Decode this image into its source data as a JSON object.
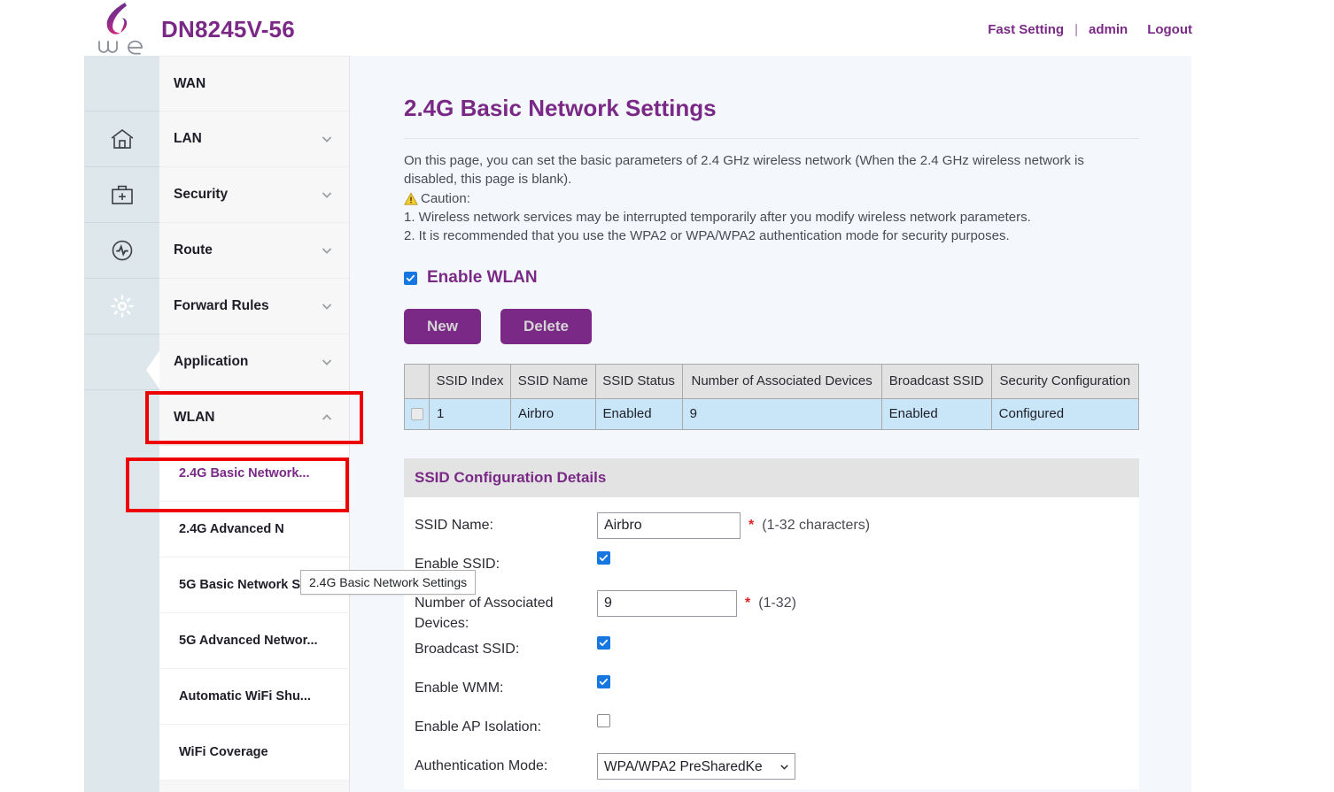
{
  "header": {
    "brand_title": "DN8245V-56",
    "logo_alt": "we-logo",
    "links": [
      {
        "label": "Fast Setting",
        "name": "fast-setting-link"
      },
      {
        "label": "admin",
        "name": "admin-link"
      },
      {
        "label": "Logout",
        "name": "logout-link"
      }
    ],
    "separator": "|"
  },
  "colors": {
    "brand_purple": "#7a2a86",
    "checkbox_blue": "#1677e0",
    "annotation_red": "#ee0000",
    "table_row_blue": "#c9e6f9",
    "table_header_gray": "#e2e2e2",
    "content_bg": "#f4f8fd",
    "rail_bg": "#dde7ec"
  },
  "rail": {
    "items": [
      {
        "icon": "blank-icon",
        "active": false
      },
      {
        "icon": "home-icon",
        "active": false
      },
      {
        "icon": "firstaid-kit-icon",
        "active": false
      },
      {
        "icon": "activity-circle-icon",
        "active": false
      },
      {
        "icon": "gear-icon",
        "active": true
      },
      {
        "icon": "blank-icon",
        "active": false
      }
    ],
    "collapse_icon": "chevron-left-icon"
  },
  "sidebar": {
    "items": [
      {
        "label": "WAN",
        "chevron": "none",
        "expanded": false
      },
      {
        "label": "LAN",
        "chevron": "down",
        "expanded": false
      },
      {
        "label": "Security",
        "chevron": "down",
        "expanded": false
      },
      {
        "label": "Route",
        "chevron": "down",
        "expanded": false
      },
      {
        "label": "Forward Rules",
        "chevron": "down",
        "expanded": false
      },
      {
        "label": "Application",
        "chevron": "down",
        "expanded": false
      },
      {
        "label": "WLAN",
        "chevron": "up",
        "expanded": true
      }
    ],
    "submenu": [
      {
        "label": "2.4G Basic Network...",
        "active": true
      },
      {
        "label": "2.4G Advanced N",
        "active": false
      },
      {
        "label": "5G Basic Network S...",
        "active": false
      },
      {
        "label": "5G Advanced Networ...",
        "active": false
      },
      {
        "label": "Automatic WiFi Shu...",
        "active": false
      },
      {
        "label": "WiFi Coverage",
        "active": false
      }
    ],
    "tooltip": "2.4G Basic Network Settings"
  },
  "main": {
    "page_title": "2.4G Basic Network Settings",
    "description_line1": "On this page, you can set the basic parameters of 2.4 GHz wireless network (When the 2.4 GHz wireless network is disabled, this page is blank).",
    "caution_icon": "warning-triangle-icon",
    "caution_label": "Caution:",
    "caution_items": [
      "1. Wireless network services may be interrupted temporarily after you modify wireless network parameters.",
      "2. It is recommended that you use the WPA2 or WPA/WPA2 authentication mode for security purposes."
    ],
    "enable_wlan": {
      "label": "Enable WLAN",
      "checked": true
    },
    "buttons": {
      "new_label": "New",
      "delete_label": "Delete"
    },
    "table": {
      "headers": [
        "SSID Index",
        "SSID Name",
        "SSID Status",
        "Number of Associated Devices",
        "Broadcast SSID",
        "Security Configuration"
      ],
      "rows": [
        {
          "selected": false,
          "ssid_index": "1",
          "ssid_name": "Airbro",
          "ssid_status": "Enabled",
          "associated_devices": "9",
          "broadcast_ssid": "Enabled",
          "security_configuration": "Configured"
        }
      ]
    },
    "section_title": "SSID Configuration Details",
    "form": {
      "ssid_name": {
        "label": "SSID Name:",
        "value": "Airbro",
        "required": "*",
        "hint": "(1-32 characters)"
      },
      "enable_ssid": {
        "label": "Enable SSID:",
        "checked": true
      },
      "assoc_devices": {
        "label": "Number of Associated Devices:",
        "value": "9",
        "required": "*",
        "hint": "(1-32)"
      },
      "broadcast_ssid": {
        "label": "Broadcast SSID:",
        "checked": true
      },
      "enable_wmm": {
        "label": "Enable WMM:",
        "checked": true
      },
      "ap_isolation": {
        "label": "Enable AP Isolation:",
        "checked": false
      },
      "auth_mode": {
        "label": "Authentication Mode:",
        "value": "WPA/WPA2 PreSharedKe",
        "chevron": "chevron-down-icon"
      }
    }
  }
}
